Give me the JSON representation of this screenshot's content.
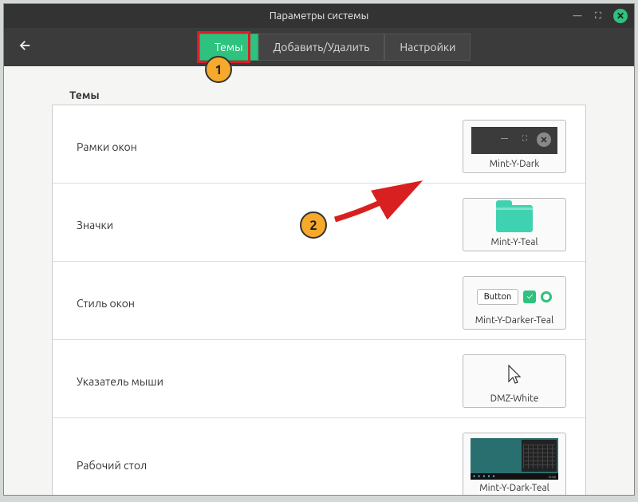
{
  "window": {
    "title": "Параметры системы"
  },
  "tabs": {
    "themes": "Темы",
    "addremove": "Добавить/Удалить",
    "settings": "Настройки"
  },
  "section": {
    "title": "Темы"
  },
  "rows": {
    "frames": {
      "label": "Рамки окон",
      "value": "Mint-Y-Dark"
    },
    "icons": {
      "label": "Значки",
      "value": "Mint-Y-Teal"
    },
    "style": {
      "label": "Стиль окон",
      "value": "Mint-Y-Darker-Teal",
      "button_text": "Button"
    },
    "cursor": {
      "label": "Указатель мыши",
      "value": "DMZ-White"
    },
    "desktop": {
      "label": "Рабочий стол",
      "value": "Mint-Y-Dark-Teal"
    }
  },
  "annotations": {
    "b1": "1",
    "b2": "2"
  }
}
